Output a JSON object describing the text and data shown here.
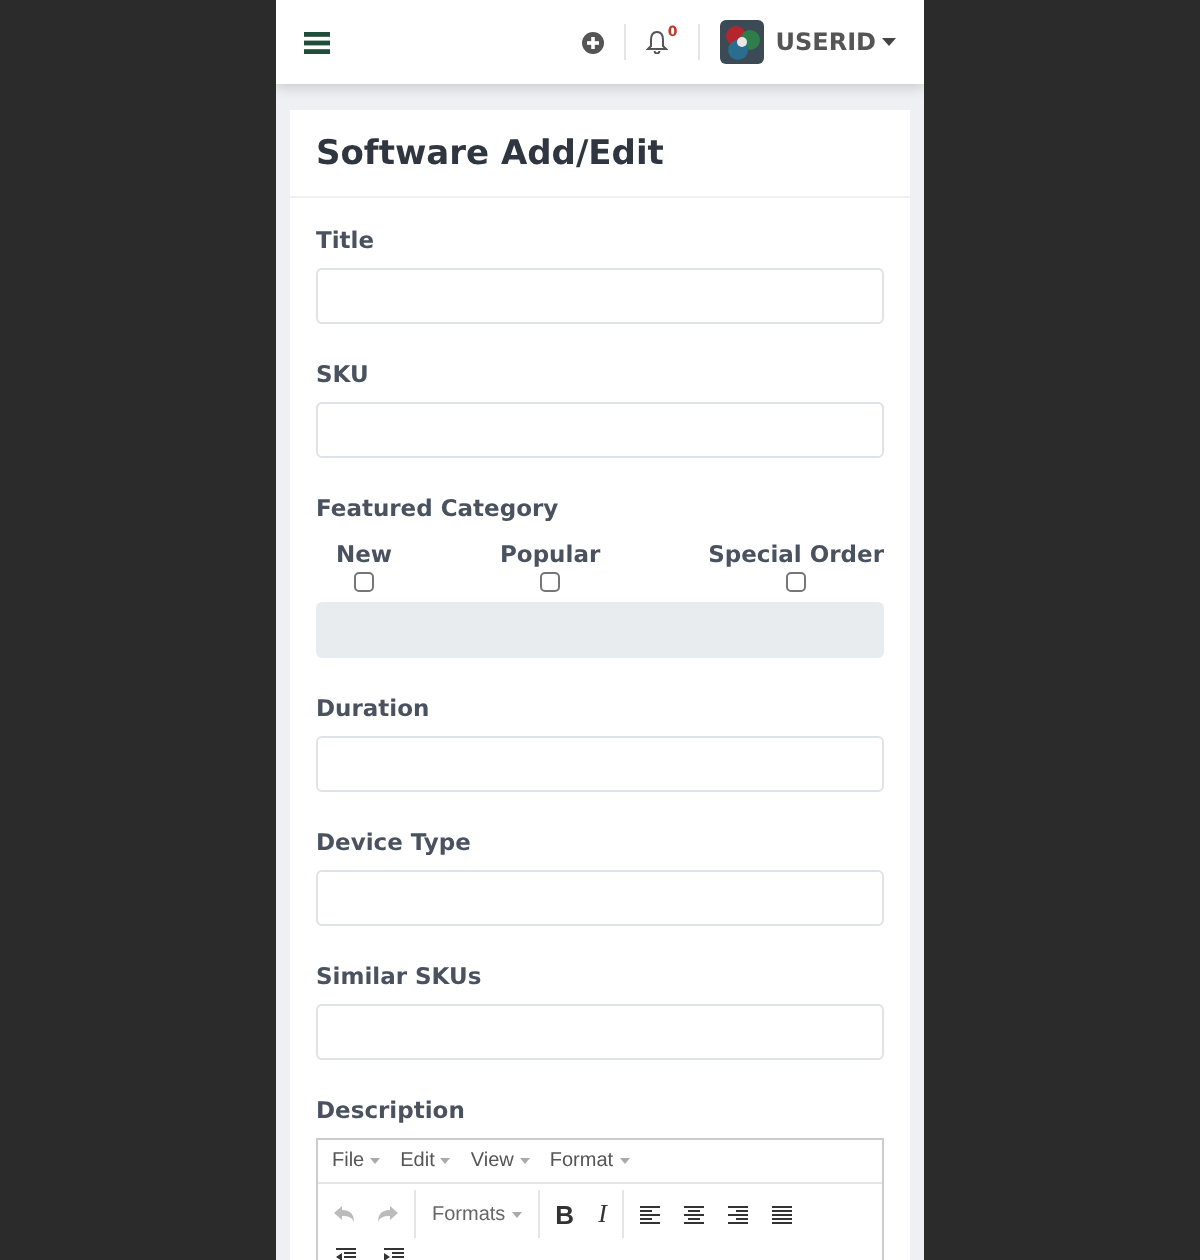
{
  "header": {
    "notification_count": "0",
    "user": "USERID"
  },
  "card": {
    "title": "Software Add/Edit"
  },
  "fields": [
    {
      "kind": "text",
      "label": "Title"
    },
    {
      "kind": "text",
      "label": "SKU"
    },
    {
      "kind": "checkbox-group",
      "label": "Featured Category",
      "options": [
        {
          "label": "New",
          "checked": false
        },
        {
          "label": "Popular",
          "checked": false
        },
        {
          "label": "Special Order",
          "checked": false
        }
      ]
    },
    {
      "kind": "text",
      "label": "Duration"
    },
    {
      "kind": "text",
      "label": "Device Type"
    },
    {
      "kind": "text",
      "label": "Similar SKUs"
    },
    {
      "kind": "editor",
      "label": "Description",
      "menus": [
        "File",
        "Edit",
        "View",
        "Format"
      ],
      "formats": "Formats",
      "bold": "B",
      "italic": "I"
    }
  ]
}
